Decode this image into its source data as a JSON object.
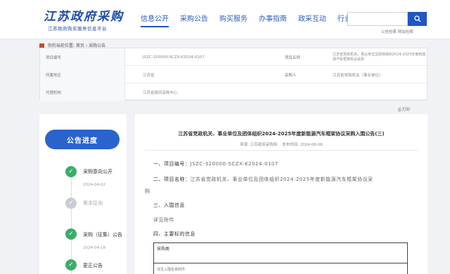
{
  "header": {
    "logo_title": "江苏政府采购",
    "logo_subtitle": "江苏政府购买服务信息平台",
    "nav": [
      "信息公开",
      "采购公告",
      "购买服务",
      "办事指南",
      "政采互动",
      "行业专题"
    ],
    "search_links": "公告检索  网站检索"
  },
  "breadcrumb": {
    "prefix": "你的当前位置:",
    "home": "首页",
    "current": "采购公告"
  },
  "info": {
    "rows": [
      {
        "label1": "项目编号",
        "value1": "JSZC-320000-SCZX-K2024-0107",
        "label2": "项目名称",
        "value2": "江苏省党政机关、事业单位及团体组织2024-2025年度新能源汽车框架协议采购"
      },
      {
        "label1": "所属地区",
        "value1": "江苏省",
        "label2": "采购人",
        "value2": "江苏省党政机关（事业单位）"
      },
      {
        "label1": "代理机构",
        "value1": "江苏省政府采购中心",
        "label2": "",
        "value2": ""
      }
    ]
  },
  "print_link": "打印",
  "progress": {
    "title": "公告进度",
    "steps": [
      {
        "label": "采购意向公开",
        "date": "2024-04-02",
        "status": "done"
      },
      {
        "label": "需求征询",
        "date": "",
        "status": "pending"
      },
      {
        "label": "采购（征集）公告",
        "date": "2024-04-18",
        "status": "done"
      },
      {
        "label": "更正公告",
        "date": "",
        "status": "done"
      }
    ]
  },
  "announcement": {
    "title": "江苏省党政机关、事业单位及团体组织2024-2025年度新能源汽车框架协议采购入围公告(三)",
    "source_label": "来源:",
    "source": "江苏政府采购网",
    "date_label": "发布时间:",
    "date": "2024-06-06",
    "item1_label": "一、项目编号：",
    "item1_value": "JSZC-320000-SCZX-K2024-0107",
    "item2_label": "二、项目名称：",
    "item2_value": "江苏省党政机关、事业单位及团体组织2024-2025年度新能源汽车框架协议采",
    "item2_wrap": "购",
    "item3": "三、入围信息",
    "item3_note": "详见附件",
    "item4": "四、主要标的信息",
    "table_header": "采购类",
    "table_cell": "详见入围名单附件"
  },
  "colors": {
    "brand_blue": "#1f57c4",
    "progress_head": "#2a63cc",
    "done_green": "#3aae67",
    "pending_grey": "#c9ccd2"
  }
}
